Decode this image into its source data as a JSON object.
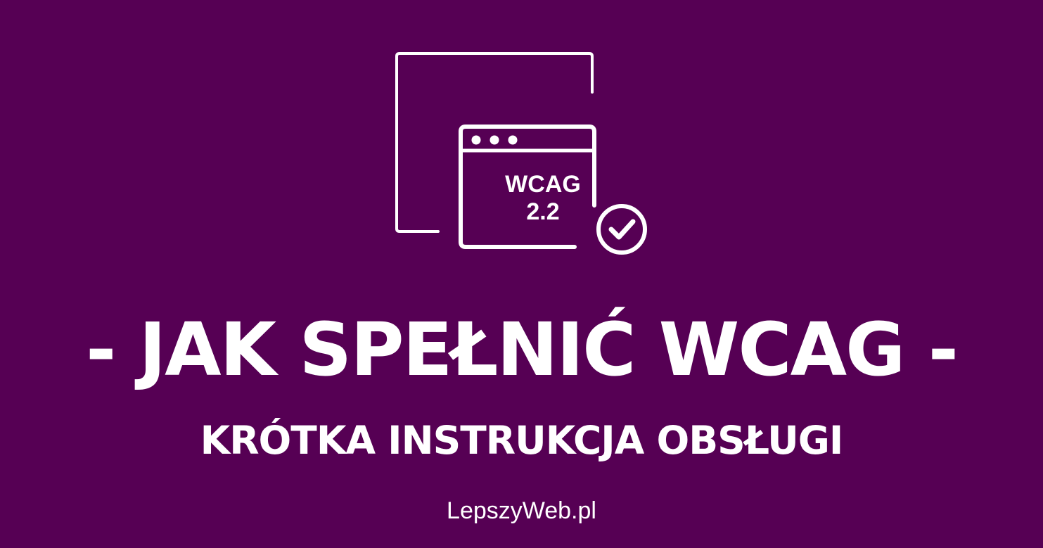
{
  "colors": {
    "background": "#560054",
    "foreground": "#ffffff"
  },
  "icon": {
    "name": "wcag-compliant-window-icon",
    "badge_line1": "WCAG",
    "badge_line2": "2.2",
    "check_icon": "check-circle-icon"
  },
  "headline": "- JAK SPEŁNIĆ WCAG -",
  "subheadline": "KRÓTKA INSTRUKCJA OBSŁUGI",
  "site": "LepszyWeb.pl"
}
